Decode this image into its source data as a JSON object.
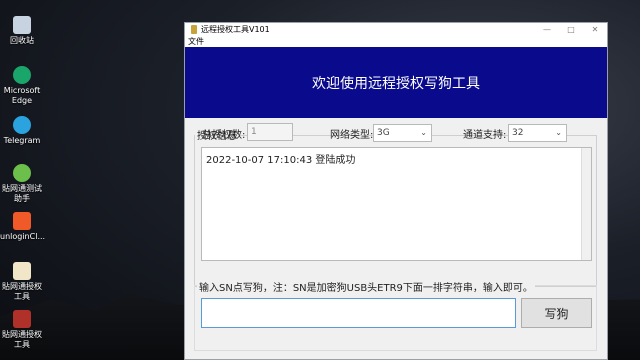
{
  "desktop": {
    "icons": [
      {
        "label": "回收站",
        "icon": "recycle-bin-icon",
        "color": "#c7d3e0"
      },
      {
        "label": "Microsoft Edge",
        "icon": "edge-icon",
        "color": "#1aa56b"
      },
      {
        "label": "Telegram",
        "icon": "telegram-icon",
        "color": "#2aa3df"
      },
      {
        "label": "貼网通测试助手",
        "icon": "tool-icon",
        "color": "#6bbf4a"
      },
      {
        "label": "unloginCl...",
        "icon": "app-icon",
        "color": "#f05a28"
      },
      {
        "label": "貼网通授权工具",
        "icon": "document-icon",
        "color": "#f2e6c8"
      },
      {
        "label": "貼网通授权工具",
        "icon": "archive-icon",
        "color": "#b0302a"
      }
    ]
  },
  "window": {
    "title": "远程授权工具V101",
    "menu": [
      "文件"
    ],
    "controls": {
      "minimize": "—",
      "maximize": "□",
      "close": "✕"
    },
    "banner": "欢迎使用远程授权写狗工具",
    "auth_group": {
      "title": "授权信息",
      "total_label": "总授权数:",
      "total_value": "1",
      "network_label": "网络类型:",
      "network_value": "3G",
      "channel_label": "通道支持:",
      "channel_value": "32"
    },
    "log": [
      "2022-10-07 17:10:43  登陆成功"
    ],
    "sn_section": {
      "note": "输入SN点写狗，注：SN是加密狗USB头ETR9下面一排字符串，输入即可。",
      "input_value": "",
      "write_button": "写狗"
    }
  },
  "colors": {
    "banner_bg": "#0a0b8c",
    "accent": "#5b9bd5"
  }
}
